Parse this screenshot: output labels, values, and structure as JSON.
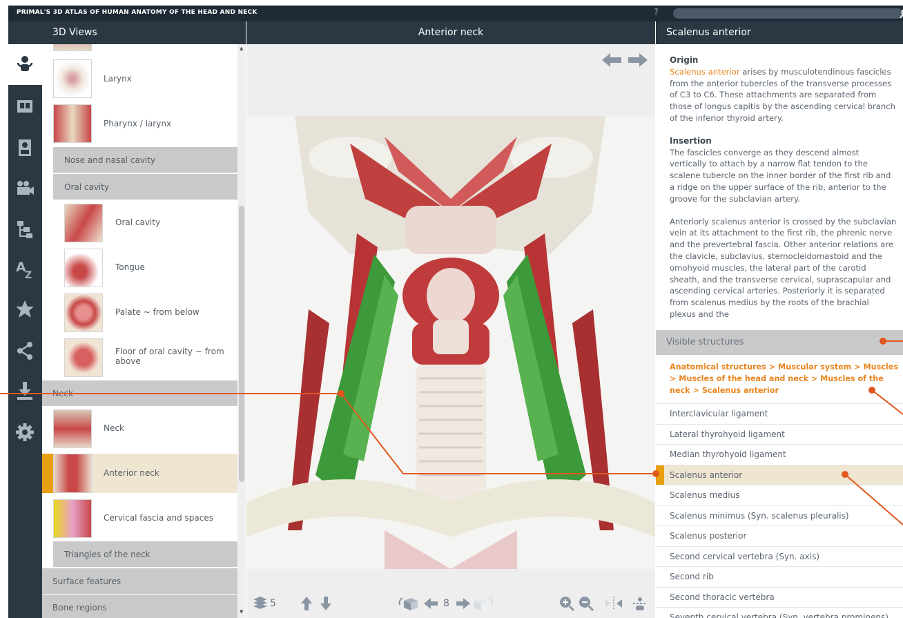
{
  "app": {
    "title": "PRIMAL'S 3D ATLAS OF HUMAN ANATOMY OF THE HEAD AND NECK",
    "help": "?"
  },
  "icons": [
    "views-icon",
    "slides-icon",
    "quiz-icon",
    "movies-icon",
    "hierarchy-icon",
    "az-index-icon",
    "favorites-icon",
    "share-icon",
    "download-icon",
    "settings-icon"
  ],
  "left_panel": {
    "title": "3D Views",
    "items": [
      {
        "label": "Larynx"
      },
      {
        "label": "Pharynx / larynx"
      },
      {
        "label": "Nose and nasal cavity"
      },
      {
        "label": "Oral cavity"
      },
      {
        "label": "Oral cavity"
      },
      {
        "label": "Tongue"
      },
      {
        "label": "Palate ~ from below"
      },
      {
        "label": "Floor of oral cavity ~ from above"
      },
      {
        "label": "Neck"
      },
      {
        "label": "Neck"
      },
      {
        "label": "Anterior neck"
      },
      {
        "label": "Cervical fascia and spaces"
      },
      {
        "label": "Triangles of the neck"
      },
      {
        "label": "Surface features"
      },
      {
        "label": "Bone regions"
      }
    ]
  },
  "viewer": {
    "title": "Anterior neck",
    "layers_count": "5",
    "slice_number": "8"
  },
  "right_panel": {
    "title": "Scalenus anterior",
    "origin_heading": "Origin",
    "origin_highlight": "Scalenus anterior",
    "origin_text": " arises by musculotendinous fascicles from the anterior tubercles of the transverse processes of C3 to C6. These attachments are separated from those of longus capitis by the ascending cervical branch of the inferior thyroid artery.",
    "insertion_heading": "Insertion",
    "insertion_text": "The fascicles converge as they descend almost vertically to attach by a narrow flat tendon to the scalene tubercle on the inner border of the first rib and a ridge on the upper surface of the rib, anterior to the groove for the subclavian artery.",
    "relations_text": "Anteriorly scalenus anterior is crossed by the subclavian vein at its attachment to the first rib, the phrenic nerve and the prevertebral fascia. Other anterior relations are the clavicle, subclavius, sternocleidomastoid and the omohyoid muscles, the lateral part of the carotid sheath, and the transverse cervical, suprascapular and ascending cervical arteries. Posteriorly it is separated from scalenus medius by the roots of the brachial plexus and the",
    "visible_title": "Visible structures",
    "breadcrumb": [
      "Anatomical structures",
      "Muscular system",
      "Muscles",
      "Muscles of the head and neck",
      "Muscles of the neck",
      "Scalenus anterior"
    ],
    "sep": ">",
    "structures": [
      "Interclavicular ligament",
      "Lateral thyrohyoid ligament",
      "Median thyrohyoid ligament",
      "Scalenus anterior",
      "Scalenus medius",
      "Scalenus minimus (Syn. scalenus pleuralis)",
      "Scalenus posterior",
      "Second cervical vertebra (Syn. axis)",
      "Second rib",
      "Second thoracic vertebra",
      "Seventh cervical vertebra (Syn. vertebra prominens)"
    ]
  },
  "colors": {
    "accent": "#e8851e",
    "dark": "#2b3844",
    "selected": "#efe6d2",
    "marker": "#e8a012",
    "callout": "#e2571e"
  }
}
